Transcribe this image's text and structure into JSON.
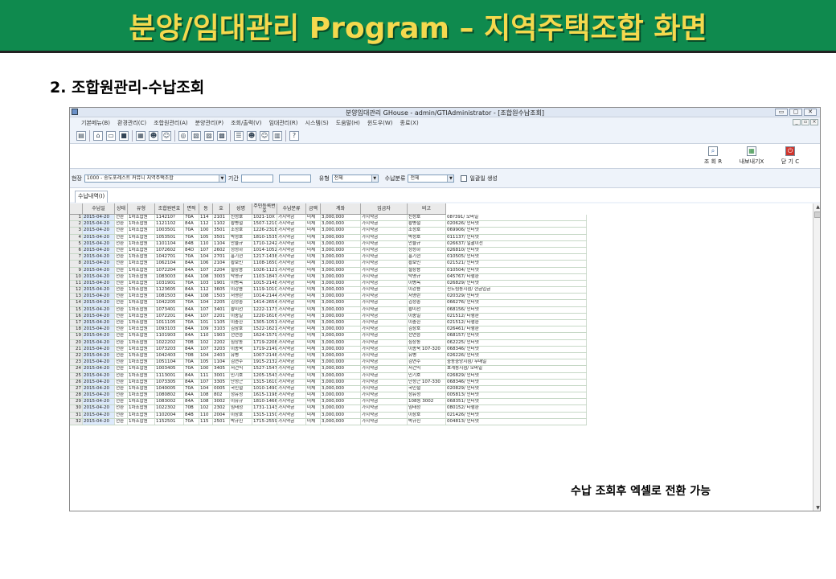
{
  "slide": {
    "title": "분양/임대관리 Program – 지역주택조합 화면",
    "subtitle": "2.  조합원관리-수납조회",
    "callout": "수납 조회후 엑셀로 전환 가능"
  },
  "window": {
    "title": "분양임대관리 GHouse - admin/GTIAdministrator - [조합원수납조회]",
    "controls": [
      "▭",
      "▢",
      "✕"
    ],
    "mdi_controls": [
      "_",
      "▫",
      "×"
    ]
  },
  "menu": [
    "기본메뉴(B)",
    "환경관리(C)",
    "조합원관리(A)",
    "분양관리(P)",
    "조회/출력(V)",
    "임대관리(R)",
    "시스템(S)",
    "도움말(H)",
    "윈도우(W)",
    "종료(X)"
  ],
  "toolbar_icons": [
    "doc-icon",
    "home-icon",
    "folder-icon",
    "save-icon",
    "grid-icon",
    "users-icon",
    "people-icon",
    "globe-icon",
    "report-icon",
    "report2-icon",
    "report3-icon",
    "list-icon",
    "group-icon",
    "people2-icon",
    "report4-icon",
    "help-icon"
  ],
  "actions": [
    {
      "label": "조 회 R",
      "icon": "search-icon",
      "color": "#3a6fb0"
    },
    {
      "label": "내보내기X",
      "icon": "excel-export-icon",
      "color": "#2c8a3c"
    },
    {
      "label": "닫 기 C",
      "icon": "close-icon",
      "color": "#d0342c"
    }
  ],
  "filter": {
    "site_label": "현장",
    "site_value": "1000 - 송도포레스트 커뮤니 지역주택조합",
    "period_label": "기간",
    "period_from": "",
    "period_to": "",
    "type_label": "유형",
    "type_value": "전체",
    "payment_type_label": "수납분류",
    "payment_type_value": "전체",
    "bulk_label": "일괄일 생성"
  },
  "tab": "수납내역(I)",
  "columns": [
    "수납일",
    "상태",
    "유형",
    "조합원번호",
    "면적",
    "동",
    "호",
    "성명",
    "주민등록번호",
    "수납분류",
    "금액",
    "계좌",
    "입금자",
    "비고"
  ],
  "rows": [
    [
      "1",
      "2015-04-20",
      "전환",
      "1차조합원",
      "114210?",
      "70A",
      "114",
      "2101",
      "신성호",
      "1021-10X",
      "가지약금",
      "미체",
      "3,000,000",
      "가지약금",
      "신성호",
      "08?391/ 모바일"
    ],
    [
      "2",
      "2015-04-20",
      "전환",
      "1차조합원",
      "1121102",
      "84A",
      "112",
      "1102",
      "황병철",
      "1507-1210",
      "가지약금",
      "미체",
      "3,000,000",
      "가지약금",
      "황병철",
      "020626/ 인터넷"
    ],
    [
      "3",
      "2015-04-20",
      "전환",
      "1차조합원",
      "1003501",
      "70A",
      "100",
      "3501",
      "조성호",
      "1226-2318",
      "가지약금",
      "미체",
      "3,000,000",
      "가지약금",
      "조성호",
      "069906/ 인터넷"
    ],
    [
      "4",
      "2015-04-20",
      "전환",
      "1차조합원",
      "1053501",
      "70A",
      "105",
      "3501",
      "박성호",
      "1810-1535",
      "가지약금",
      "미체",
      "3,000,000",
      "가지약금",
      "박성호",
      "011137/ 인터넷"
    ],
    [
      "5",
      "2015-04-20",
      "전환",
      "1차조합원",
      "1101104",
      "84B",
      "110",
      "1104",
      "안율규",
      "1710-1242",
      "가지약금",
      "미체",
      "3,000,000",
      "가지약금",
      "안율규",
      "026637/ 일괄이천"
    ],
    [
      "6",
      "2015-04-20",
      "전환",
      "1차조합원",
      "1072602",
      "84D",
      "107",
      "2602",
      "정성하",
      "1014-1052",
      "가지약금",
      "미체",
      "3,000,000",
      "가지약금",
      "정성하",
      "026810/ 인터넷"
    ],
    [
      "7",
      "2015-04-20",
      "전환",
      "1차조합원",
      "1042701",
      "70A",
      "104",
      "2701",
      "홍기현",
      "1217-1438",
      "가지약금",
      "미체",
      "3,000,000",
      "가지약금",
      "홍기현",
      "010505/ 인터넷"
    ],
    [
      "8",
      "2015-04-20",
      "전환",
      "1차조합원",
      "1062104",
      "84A",
      "106",
      "2104",
      "황보민",
      "1108-1650",
      "가지약금",
      "미체",
      "3,000,000",
      "가지약금",
      "황보민",
      "021521/ 인터넷"
    ],
    [
      "9",
      "2015-04-20",
      "전환",
      "1차조합원",
      "1072204",
      "84A",
      "107",
      "2204",
      "설창용",
      "1026-1121",
      "가지약금",
      "미체",
      "3,000,000",
      "가지약금",
      "설창용",
      "010504/ 인터넷"
    ],
    [
      "10",
      "2015-04-20",
      "전환",
      "1차조합원",
      "1083003",
      "84A",
      "108",
      "3003",
      "탁명규",
      "1103-1847",
      "가지약금",
      "미체",
      "3,000,000",
      "가지약금",
      "탁명규",
      "045767/ 타행환"
    ],
    [
      "11",
      "2015-04-20",
      "전환",
      "1차조합원",
      "1031901",
      "70A",
      "103",
      "1901",
      "이병옥",
      "1015-2148",
      "가지약금",
      "미체",
      "3,000,000",
      "가지약금",
      "이병옥",
      "026829/ 인터넷"
    ],
    [
      "12",
      "2015-04-20",
      "전환",
      "1차조합원",
      "1123605",
      "84A",
      "112",
      "3605",
      "이강용",
      "1119-1010",
      "가지약금",
      "미체",
      "3,000,000",
      "가지약금",
      "이강용",
      "신도림동지점/ 현금입금"
    ],
    [
      "13",
      "2015-04-20",
      "전환",
      "1차조합원",
      "1081503",
      "84A",
      "108",
      "1503",
      "서영란",
      "1014-2144",
      "가지약금",
      "미체",
      "3,000,000",
      "가지약금",
      "서영란",
      "020329/ 인터넷"
    ],
    [
      "14",
      "2015-04-20",
      "전환",
      "1차조합원",
      "1042205",
      "70A",
      "104",
      "2205",
      "김정중",
      "1414-2654",
      "가지약금",
      "미체",
      "3,000,000",
      "가지약금",
      "김정중",
      "066276/ 인터넷"
    ],
    [
      "15",
      "2015-04-20",
      "전환",
      "1차조합원",
      "1073401",
      "84A",
      "107",
      "3401",
      "황미선",
      "1222-1173",
      "가지약금",
      "미체",
      "3,000,000",
      "가지약금",
      "황미선",
      "068156/ 인터넷"
    ],
    [
      "16",
      "2015-04-20",
      "전환",
      "1차조합원",
      "1072201",
      "84A",
      "107",
      "2201",
      "이충일",
      "1220-1616",
      "가지약금",
      "미체",
      "3,000,000",
      "가지약금",
      "이충일",
      "021512/ 타행환"
    ],
    [
      "17",
      "2015-04-20",
      "전환",
      "1차조합원",
      "1011105",
      "70A",
      "101",
      "1105",
      "이충한",
      "1305-1051",
      "가지약금",
      "미체",
      "3,000,000",
      "가지약금",
      "이충한",
      "021512/ 타행환"
    ],
    [
      "18",
      "2015-04-20",
      "전환",
      "1차조합원",
      "1093103",
      "84A",
      "109",
      "3103",
      "김창호",
      "1522-1621",
      "가지약금",
      "미체",
      "3,000,000",
      "가지약금",
      "김창호",
      "026461/ 타행환"
    ],
    [
      "19",
      "2015-04-20",
      "전환",
      "1차조합원",
      "1101903",
      "84A",
      "110",
      "1903",
      "전연승",
      "1624-1579",
      "가지약금",
      "미체",
      "3,000,000",
      "가지약금",
      "전연승",
      "068157/ 인터넷"
    ],
    [
      "20",
      "2015-04-20",
      "전환",
      "1차조합원",
      "1022202",
      "70B",
      "102",
      "2202",
      "심상동",
      "1719-2208",
      "가지약금",
      "미체",
      "3,000,000",
      "가지약금",
      "심상동",
      "062225/ 인터넷"
    ],
    [
      "21",
      "2015-04-20",
      "전환",
      "1차조합원",
      "1073203",
      "84A",
      "107",
      "3203",
      "이종욱",
      "1719-2149",
      "가지약금",
      "미체",
      "3,000,000",
      "가지약금",
      "이종욱 107-320",
      "068346/ 인터넷"
    ],
    [
      "22",
      "2015-04-20",
      "전환",
      "1차조합원",
      "1042403",
      "70B",
      "104",
      "2403",
      "유병",
      "1007-2148",
      "가지약금",
      "미체",
      "3,000,000",
      "가지약금",
      "유병",
      "026226/ 인터넷"
    ],
    [
      "23",
      "2015-04-20",
      "전환",
      "1차조합원",
      "1051104",
      "70A",
      "105",
      "1104",
      "김연수",
      "1915-2132",
      "가지약금",
      "미체",
      "3,000,000",
      "가지약금",
      "김연수",
      "중동중앙지점/ 무매일"
    ],
    [
      "24",
      "2015-04-20",
      "전환",
      "1차조합원",
      "1003405",
      "70A",
      "100",
      "3405",
      "서건익",
      "1527-1547",
      "가지약금",
      "미체",
      "3,000,000",
      "가지약금",
      "서건익",
      "호계동지점/ 모바일"
    ],
    [
      "25",
      "2015-04-20",
      "전환",
      "1차조합원",
      "1113001",
      "84A",
      "111",
      "3001",
      "민기호",
      "1205-1543",
      "가지약금",
      "미체",
      "3,000,000",
      "가지약금",
      "민기호",
      "026829/ 인터넷"
    ],
    [
      "26",
      "2015-04-20",
      "전환",
      "1차조합원",
      "1073305",
      "84A",
      "107",
      "3305",
      "단성근",
      "1315-1610",
      "가지약금",
      "미체",
      "3,000,000",
      "가지약금",
      "단성근 107-330",
      "068346/ 인터넷"
    ],
    [
      "27",
      "2015-04-20",
      "전환",
      "1차조합원",
      "1040005",
      "70A",
      "104",
      "0005",
      "국민철",
      "1010-1490",
      "가지약금",
      "미체",
      "3,000,000",
      "가지약금",
      "국민철",
      "020829/ 인터넷"
    ],
    [
      "28",
      "2015-04-20",
      "전환",
      "1차조합원",
      "1080802",
      "84A",
      "108",
      "802",
      "정유성",
      "1615-1198",
      "가지약금",
      "미체",
      "3,000,000",
      "가지약금",
      "정유성",
      "005813/ 인터넷"
    ],
    [
      "29",
      "2015-04-20",
      "전환",
      "1차조합원",
      "1083002",
      "84A",
      "108",
      "3002",
      "이유규",
      "1810-1466",
      "가지약금",
      "미체",
      "3,000,000",
      "가지약금",
      "108동 3002",
      "068351/ 인터넷"
    ],
    [
      "30",
      "2015-04-20",
      "전환",
      "1차조합원",
      "1022302",
      "70B",
      "102",
      "2302",
      "임태정",
      "1731-1143",
      "가지약금",
      "미체",
      "3,000,000",
      "가지약금",
      "임태정",
      "080152/ 타행환"
    ],
    [
      "31",
      "2015-04-20",
      "전환",
      "1차조합원",
      "1102004",
      "84B",
      "110",
      "2004",
      "이창호",
      "1315-1150",
      "가지약금",
      "미체",
      "3,000,000",
      "가지약금",
      "이창호",
      "021426/ 인터넷"
    ],
    [
      "32",
      "2015-04-20",
      "전환",
      "1차조합원",
      "1152501",
      "70A",
      "115",
      "2501",
      "박규진",
      "1715-2559",
      "가지약금",
      "미체",
      "3,000,000",
      "가지약금",
      "박규진",
      "004813/ 인터넷"
    ]
  ],
  "colors": {
    "banner": "#0f8a4e",
    "banner_text": "#f5d94e",
    "date_cell": "#ddeafc"
  }
}
